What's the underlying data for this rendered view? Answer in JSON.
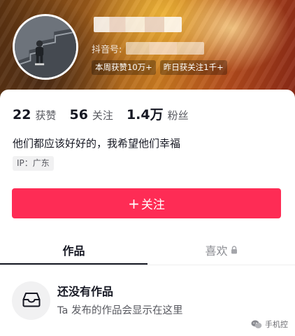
{
  "profile": {
    "display_name": "█████",
    "douyin_label": "抖音号:",
    "douyin_id": "█████",
    "tags": [
      "本周获赞10万+",
      "昨日获关注1千+"
    ]
  },
  "stats": [
    {
      "value": "22",
      "label": "获赞"
    },
    {
      "value": "56",
      "label": "关注"
    },
    {
      "value": "1.4万",
      "label": "粉丝"
    }
  ],
  "bio": "他们都应该好好的，我希望他们幸福",
  "ip": "IP：广东",
  "follow_button": {
    "plus": "+",
    "label": "关注"
  },
  "tabs": [
    {
      "label": "作品",
      "active": true
    },
    {
      "label": "喜欢",
      "locked": true
    }
  ],
  "empty_state": {
    "title": "还没有作品",
    "subtitle": "Ta 发布的作品会显示在这里",
    "icon": "inbox-tray-icon"
  },
  "watermark": {
    "text": "手机控",
    "icon": "wechat-bubble-icon"
  },
  "colors": {
    "accent": "#fe2c55",
    "text_primary": "#161823",
    "text_secondary": "#57585f",
    "tab_inactive": "#8a8b91"
  }
}
